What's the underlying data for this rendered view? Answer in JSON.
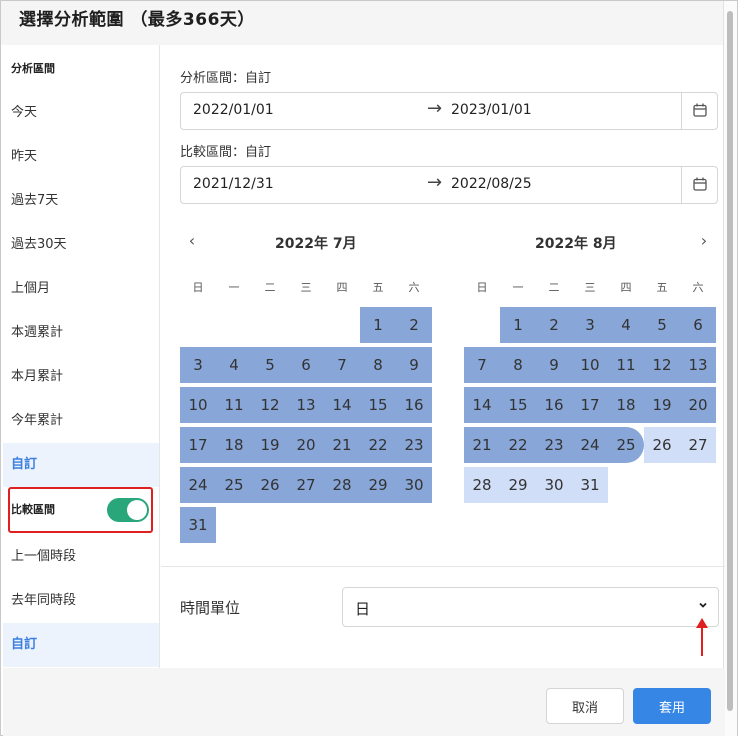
{
  "dialog": {
    "title": "選擇分析範圍 （最多366天）"
  },
  "sidebar": {
    "analysis_header": "分析區間",
    "items": [
      "今天",
      "昨天",
      "過去7天",
      "過去30天",
      "上個月",
      "本週累計",
      "本月累計",
      "今年累計",
      "自訂"
    ],
    "compare_label": "比較區間",
    "compare_enabled": true,
    "compare_items": [
      "上一個時段",
      "去年同時段",
      "自訂"
    ]
  },
  "analysis": {
    "label": "分析區間：自訂",
    "start": "2022/01/01",
    "end": "2023/01/01"
  },
  "compare": {
    "label": "比較區間：自訂",
    "start": "2021/12/31",
    "end": "2022/08/25"
  },
  "calendar": {
    "arrow": "→",
    "nav_prev": "‹",
    "nav_next": "›",
    "weekdays": [
      "日",
      "一",
      "二",
      "三",
      "四",
      "五",
      "六"
    ],
    "months": [
      {
        "title": "2022年 7月",
        "first_weekday": 5,
        "days": 31,
        "range_end_day": 31
      },
      {
        "title": "2022年 8月",
        "first_weekday": 1,
        "days": 31,
        "range_end_day": 25
      }
    ]
  },
  "time_unit": {
    "label": "時間單位",
    "value": "日"
  },
  "footer": {
    "cancel": "取消",
    "apply": "套用"
  },
  "colors": {
    "range_fill": "#88a6d8",
    "analysis_only_fill": "#d0def8",
    "accent": "#3686e6",
    "toggle_on": "#29a67a",
    "annotation": "#e02020"
  },
  "icons": {
    "calendar": "calendar-icon",
    "arrow": "arrow-right-icon",
    "select": "chevron-down-icon"
  }
}
